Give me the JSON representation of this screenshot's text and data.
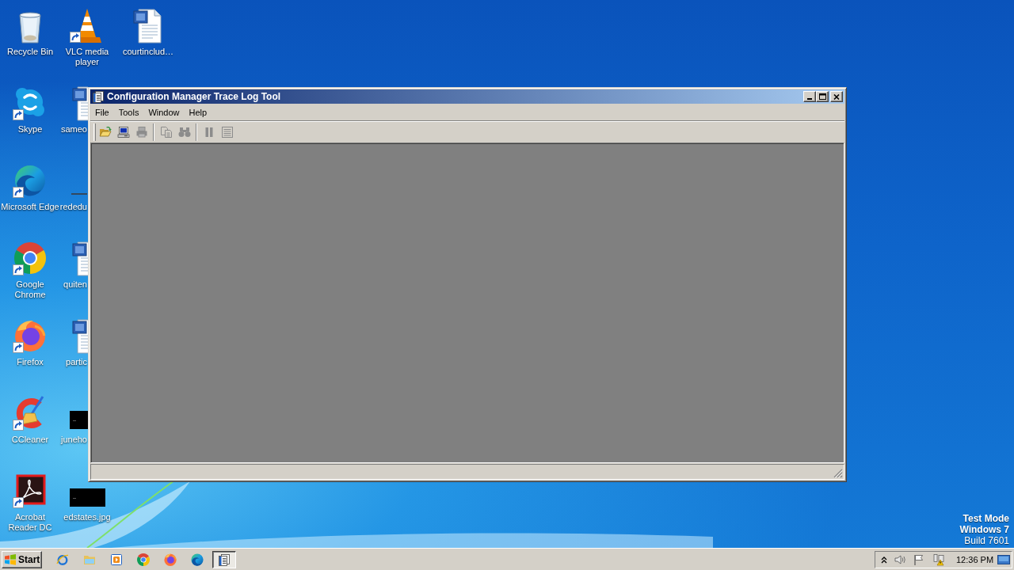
{
  "desktop": {
    "icon_columns": [
      [
        {
          "label": "Recycle Bin",
          "kind": "bin",
          "shortcut": false,
          "partly_hidden": false
        },
        {
          "label": "Skype",
          "kind": "skype",
          "shortcut": true,
          "partly_hidden": false
        },
        {
          "label": "Microsoft Edge",
          "kind": "edge",
          "shortcut": true,
          "partly_hidden": false
        },
        {
          "label": "Google Chrome",
          "kind": "chrome",
          "shortcut": true,
          "partly_hidden": false
        },
        {
          "label": "Firefox",
          "kind": "firefox",
          "shortcut": true,
          "partly_hidden": false
        },
        {
          "label": "CCleaner",
          "kind": "ccleaner",
          "shortcut": true,
          "partly_hidden": false
        },
        {
          "label": "Acrobat Reader DC",
          "kind": "acrobat",
          "shortcut": true,
          "partly_hidden": false
        }
      ],
      [
        {
          "label": "VLC media player",
          "kind": "vlc",
          "shortcut": true,
          "partly_hidden": false
        },
        {
          "label": "sameo",
          "kind": "document",
          "shortcut": false,
          "partly_hidden": true
        },
        {
          "label": "rededu",
          "kind": "strip",
          "shortcut": false,
          "partly_hidden": true
        },
        {
          "label": "quiten",
          "kind": "document",
          "shortcut": false,
          "partly_hidden": true
        },
        {
          "label": "partic",
          "kind": "document",
          "shortcut": false,
          "partly_hidden": true
        },
        {
          "label": "juneho",
          "kind": "image",
          "shortcut": false,
          "partly_hidden": true
        },
        {
          "label": "edstates.jpg",
          "kind": "image",
          "shortcut": false,
          "partly_hidden": false
        }
      ],
      [
        {
          "label": "courtinclud…",
          "kind": "document",
          "shortcut": false,
          "partly_hidden": false
        }
      ]
    ],
    "notice": [
      {
        "text": "Test Mode",
        "bold": true
      },
      {
        "text": "Windows 7",
        "bold": true
      },
      {
        "text": "Build 7601",
        "bold": false
      }
    ]
  },
  "window": {
    "title": "Configuration Manager Trace Log Tool",
    "menu": [
      "File",
      "Tools",
      "Window",
      "Help"
    ],
    "toolbar": [
      [
        {
          "kind": "open",
          "disabled": false
        },
        {
          "kind": "computer",
          "disabled": false
        },
        {
          "kind": "print",
          "disabled": true
        }
      ],
      [
        {
          "kind": "copy",
          "disabled": true
        },
        {
          "kind": "find",
          "disabled": true
        }
      ],
      [
        {
          "kind": "pause",
          "disabled": true
        },
        {
          "kind": "list",
          "disabled": true
        }
      ]
    ]
  },
  "taskbar": {
    "start": "Start",
    "tasks": [
      {
        "selected": true
      }
    ],
    "clock": "12:36 PM"
  }
}
